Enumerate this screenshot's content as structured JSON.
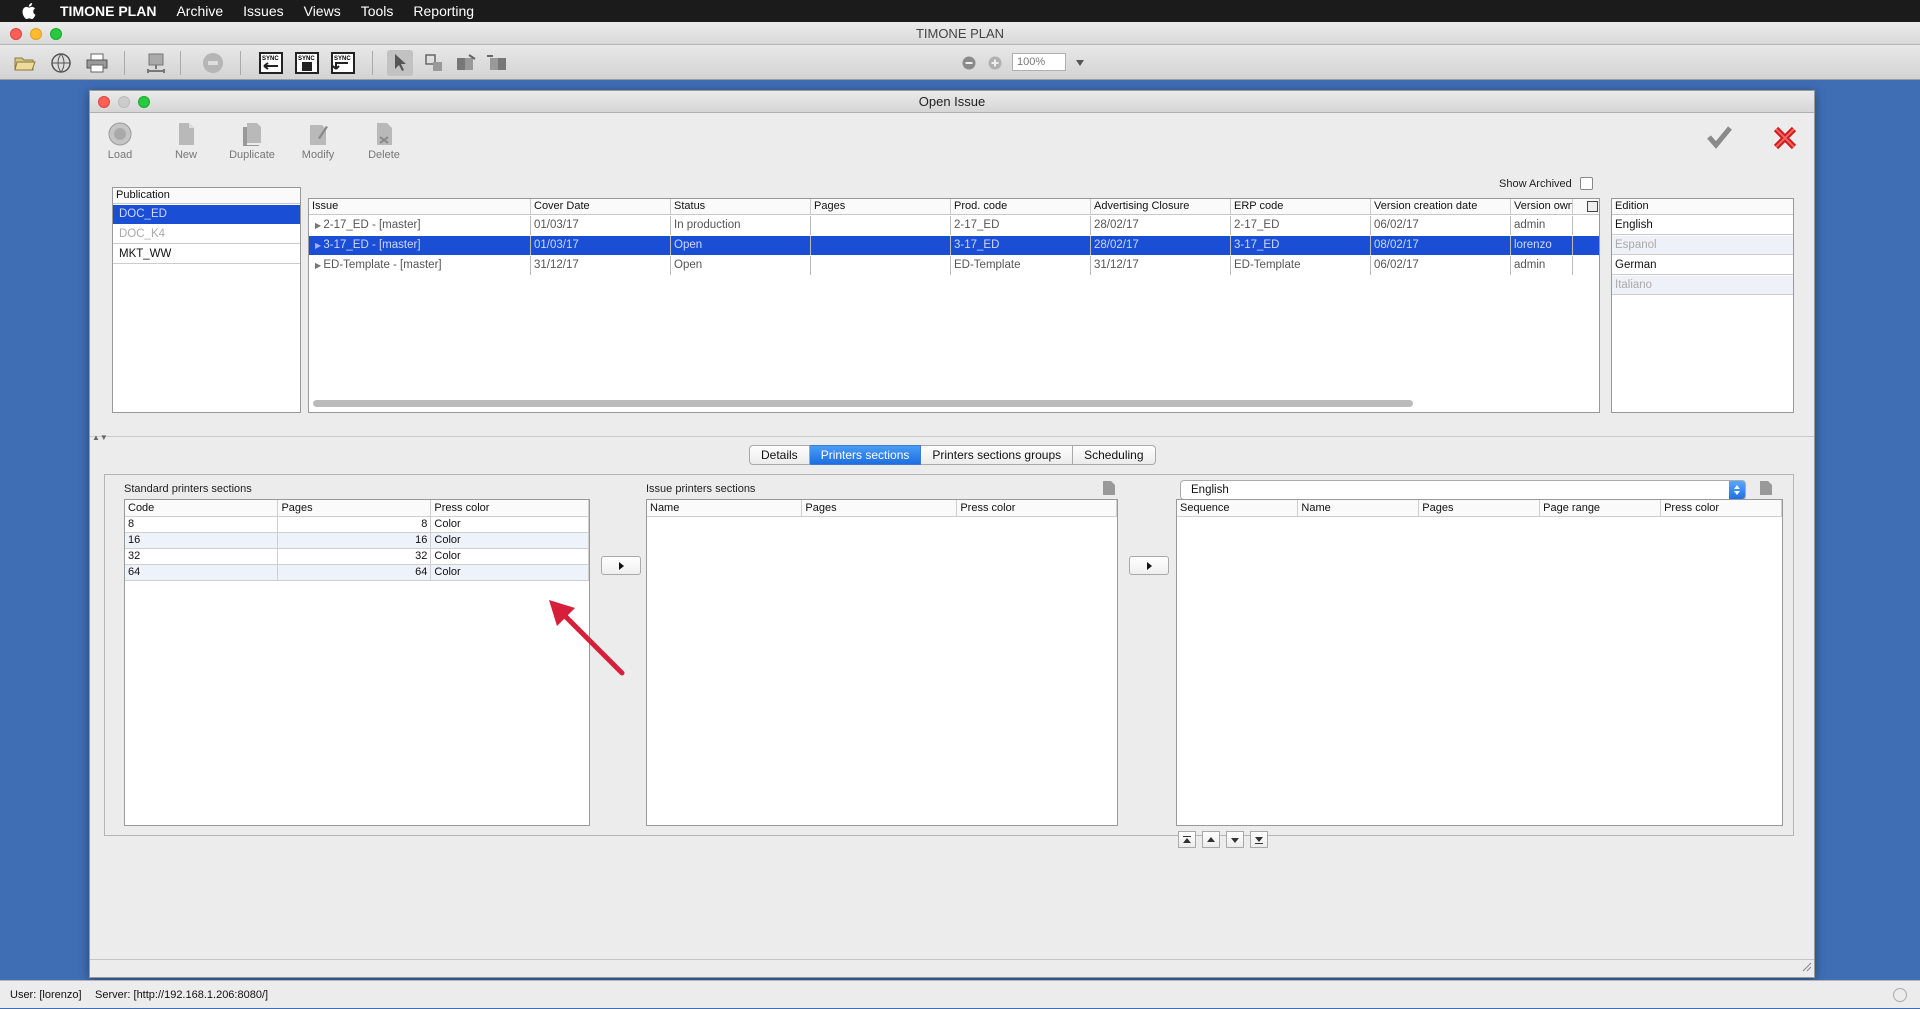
{
  "menubar": {
    "app_name": "TIMONE PLAN",
    "items": [
      "Archive",
      "Issues",
      "Views",
      "Tools",
      "Reporting"
    ]
  },
  "main_window": {
    "title": "TIMONE PLAN",
    "zoom": "100%"
  },
  "dialog": {
    "title": "Open Issue",
    "actions": [
      {
        "label": "Load",
        "icon": "load-icon"
      },
      {
        "label": "New",
        "icon": "new-document-icon"
      },
      {
        "label": "Duplicate",
        "icon": "duplicate-icon"
      },
      {
        "label": "Modify",
        "icon": "modify-icon"
      },
      {
        "label": "Delete",
        "icon": "delete-icon"
      }
    ],
    "show_archived_label": "Show Archived",
    "publication": {
      "header": "Publication",
      "items": [
        "DOC_ED",
        "DOC_K4",
        "MKT_WW"
      ],
      "selected_index": 0
    },
    "issues": {
      "columns": [
        "Issue",
        "Cover Date",
        "Status",
        "Pages",
        "Prod. code",
        "Advertising Closure",
        "ERP code",
        "Version creation date",
        "Version owne"
      ],
      "rows": [
        [
          "2-17_ED - [master]",
          "01/03/17",
          "In production",
          "",
          "2-17_ED",
          "28/02/17",
          "2-17_ED",
          "06/02/17",
          "admin"
        ],
        [
          "3-17_ED - [master]",
          "01/03/17",
          "Open",
          "",
          "3-17_ED",
          "28/02/17",
          "3-17_ED",
          "08/02/17",
          "lorenzo"
        ],
        [
          "ED-Template - [master]",
          "31/12/17",
          "Open",
          "",
          "ED-Template",
          "31/12/17",
          "ED-Template",
          "06/02/17",
          "admin"
        ]
      ],
      "selected_index": 1
    },
    "edition": {
      "header": "Edition",
      "items": [
        "English",
        "Espanol",
        "German",
        "Italiano"
      ]
    },
    "tabs": [
      "Details",
      "Printers sections",
      "Printers sections groups",
      "Scheduling"
    ],
    "active_tab": 1,
    "standard_sections": {
      "label": "Standard printers sections",
      "columns": [
        "Code",
        "Pages",
        "Press color"
      ],
      "rows": [
        [
          "8",
          "8",
          "Color"
        ],
        [
          "16",
          "16",
          "Color"
        ],
        [
          "32",
          "32",
          "Color"
        ],
        [
          "64",
          "64",
          "Color"
        ]
      ]
    },
    "issue_sections": {
      "label": "Issue printers sections",
      "columns": [
        "Name",
        "Pages",
        "Press color"
      ]
    },
    "edition_sections": {
      "selected_edition": "English",
      "columns": [
        "Sequence",
        "Name",
        "Pages",
        "Page range",
        "Press color"
      ]
    }
  },
  "statusbar": {
    "user": "User: [lorenzo]",
    "server": "Server: [http://192.168.1.206:8080/]"
  },
  "colors": {
    "selection": "#1a4fd5",
    "accent_tab": "#1d6ee3",
    "annotation_arrow": "#d61f3a",
    "desktop": "#3f6eb5"
  }
}
